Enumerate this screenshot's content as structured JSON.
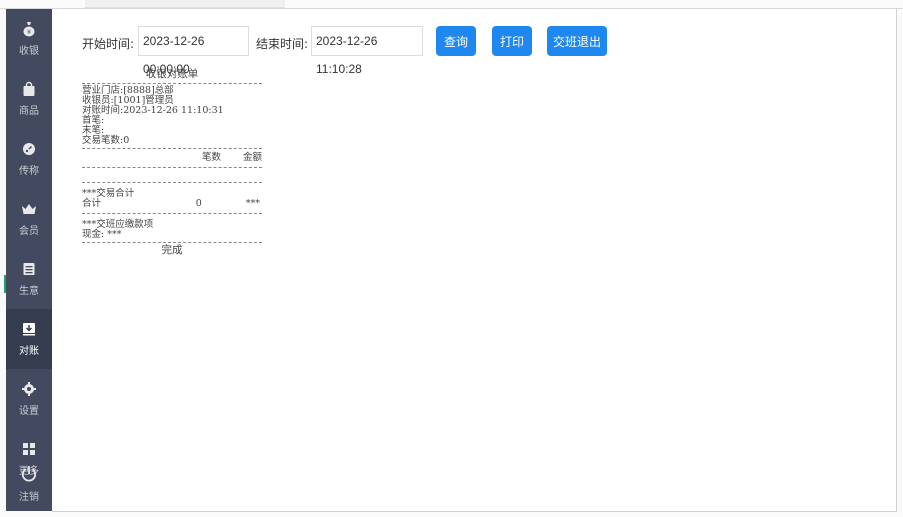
{
  "nav": {
    "items": [
      {
        "label": "收银",
        "icon": "money-bag-icon"
      },
      {
        "label": "商品",
        "icon": "shopping-bag-icon"
      },
      {
        "label": "传称",
        "icon": "scale-icon"
      },
      {
        "label": "会员",
        "icon": "crown-icon"
      },
      {
        "label": "生意",
        "icon": "report-icon"
      },
      {
        "label": "对账",
        "icon": "download-tray-icon"
      },
      {
        "label": "设置",
        "icon": "gear-icon"
      },
      {
        "label": "更多",
        "icon": "grid-icon"
      },
      {
        "label": "注销",
        "icon": "power-icon"
      }
    ],
    "active_index": 5
  },
  "toolbar": {
    "start_label": "开始时间:",
    "start_value": "2023-12-26 00:00:00",
    "end_label": "结束时间:",
    "end_value": "2023-12-26 11:10:28",
    "query_label": "查询",
    "print_label": "打印",
    "shift_label": "交班退出"
  },
  "receipt": {
    "title": "收银对账单",
    "lines": [
      "营业门店:[8888]总部",
      "收银员:[1001]管理员",
      "对账时间:2023-12-26 11:10:31",
      "首笔:",
      "末笔:",
      "交易笔数:0"
    ],
    "col_count": "笔数",
    "col_amount": "金额",
    "section_trade": "***交易合计",
    "total_label": "合计",
    "total_count": "0",
    "total_amount": "***",
    "section_due": "***交班应缴款项",
    "cash_line": "现金: ***",
    "footer": "完成"
  },
  "colors": {
    "sidebar": "#434a5f",
    "sidebar_active": "#363c4f",
    "button": "#1e88f0"
  }
}
